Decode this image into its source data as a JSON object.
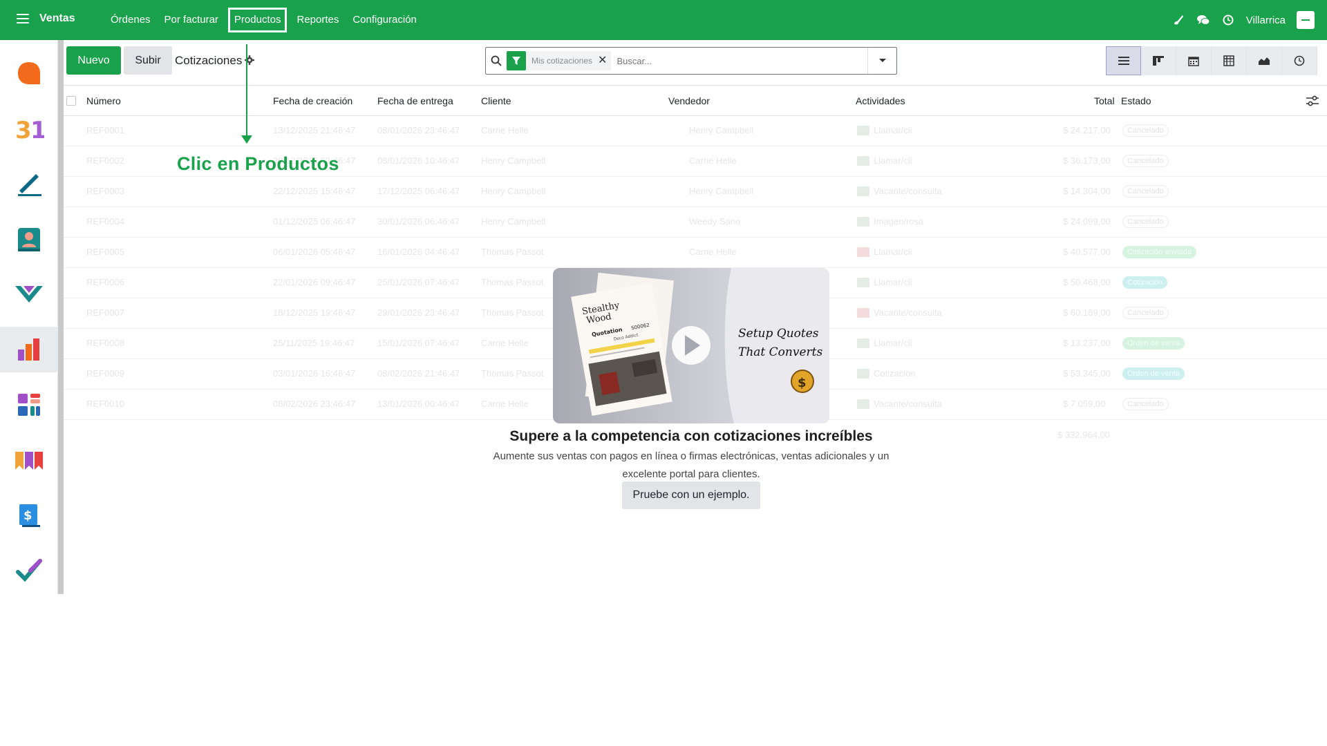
{
  "app": {
    "name": "Ventas",
    "company": "Villarrica"
  },
  "menu": [
    {
      "label": "Órdenes"
    },
    {
      "label": "Por facturar"
    },
    {
      "label": "Productos"
    },
    {
      "label": "Reportes"
    },
    {
      "label": "Configuración"
    }
  ],
  "control_panel": {
    "new_label": "Nuevo",
    "upload_label": "Subir",
    "breadcrumb": "Cotizaciones",
    "facet_label": "Mis cotizaciones",
    "search_placeholder": "Buscar..."
  },
  "table": {
    "columns": [
      "Número",
      "Fecha de creación",
      "Fecha de entrega",
      "Cliente",
      "Vendedor",
      "Actividades",
      "Total",
      "Estado"
    ],
    "rows": [
      {
        "number": "REF0001",
        "created": "13/12/2025 21:46:47",
        "delivery": "08/01/2026 23:46:47",
        "customer": "Carrie Helle",
        "salesperson": "Henry Campbell",
        "activity": "Llamar/cli",
        "total": "$ 24.217,00",
        "status": "Cancelado"
      },
      {
        "number": "REF0002",
        "created": "30/12/2025 02:46:47",
        "delivery": "08/01/2026 10:46:47",
        "customer": "Henry Campbell",
        "salesperson": "Carrie Helle",
        "activity": "Llamar/cli",
        "total": "$ 36.173,00",
        "status": "Cancelado"
      },
      {
        "number": "REF0003",
        "created": "22/12/2025 15:46:47",
        "delivery": "17/12/2025 06:46:47",
        "customer": "Henry Campbell",
        "salesperson": "Henry Campbell",
        "activity": "Vacante/consulta",
        "total": "$ 14.304,00",
        "status": "Cancelado"
      },
      {
        "number": "REF0004",
        "created": "01/12/2025 06:46:47",
        "delivery": "30/01/2026 06:46:47",
        "customer": "Henry Campbell",
        "salesperson": "Weedy Sano",
        "activity": "Imagen/rosa",
        "total": "$ 24.099,00",
        "status": "Cancelado"
      },
      {
        "number": "REF0005",
        "created": "06/01/2026 05:46:47",
        "delivery": "16/01/2026 04:46:47",
        "customer": "Thomas Passot",
        "salesperson": "Carrie Helle",
        "activity": "Llamar/cli",
        "total": "$ 40.577,00",
        "status": "Cotización enviada"
      },
      {
        "number": "REF0006",
        "created": "22/01/2026 09:46:47",
        "delivery": "25/01/2026 07:46:47",
        "customer": "Thomas Passot",
        "salesperson": "",
        "activity": "Llamar/cli",
        "total": "$ 50.468,00",
        "status": "Cotización"
      },
      {
        "number": "REF0007",
        "created": "18/12/2025 19:46:47",
        "delivery": "29/01/2026 23:46:47",
        "customer": "Thomas Passot",
        "salesperson": "",
        "activity": "Vacante/consulta",
        "total": "$ 60.169,00",
        "status": "Cancelado"
      },
      {
        "number": "REF0008",
        "created": "25/11/2025 19:46:47",
        "delivery": "15/01/2026 07:46:47",
        "customer": "Carrie Helle",
        "salesperson": "",
        "activity": "Llamar/cli",
        "total": "$ 13.237,00",
        "status": "Orden de venta"
      },
      {
        "number": "REF0009",
        "created": "03/01/2026 16:46:47",
        "delivery": "08/02/2026 21:46:47",
        "customer": "Thomas Passot",
        "salesperson": "",
        "activity": "Cotizacion",
        "total": "$ 53.345,00",
        "status": "Orden de venta"
      },
      {
        "number": "REF0010",
        "created": "08/02/2026 23:46:47",
        "delivery": "13/01/2026 00:46:47",
        "customer": "Carrie Helle",
        "salesperson": "",
        "activity": "Vacante/consulta",
        "total": "$ 7.059,00",
        "status": "Cancelado"
      }
    ],
    "sum": "$ 332.964,00"
  },
  "annotation": {
    "text": "Clic en Productos"
  },
  "helper": {
    "video_title_line1": "Setup Quotes",
    "video_title_line2": "That Converts",
    "doc_brand_line1": "Stealthy",
    "doc_brand_line2": "Wood",
    "doc_quotation": "Quotation",
    "doc_number": "S00062",
    "doc_customer": "Deco Addict",
    "title": "Supere a la competencia con cotizaciones increíbles",
    "subtitle": "Aumente sus ventas con pagos en línea o firmas electrónicas, ventas adicionales y un excelente portal para clientes.",
    "button": "Pruebe con un ejemplo."
  },
  "colors": {
    "brand": "#1aa14b",
    "annotation": "#1aa14b"
  }
}
